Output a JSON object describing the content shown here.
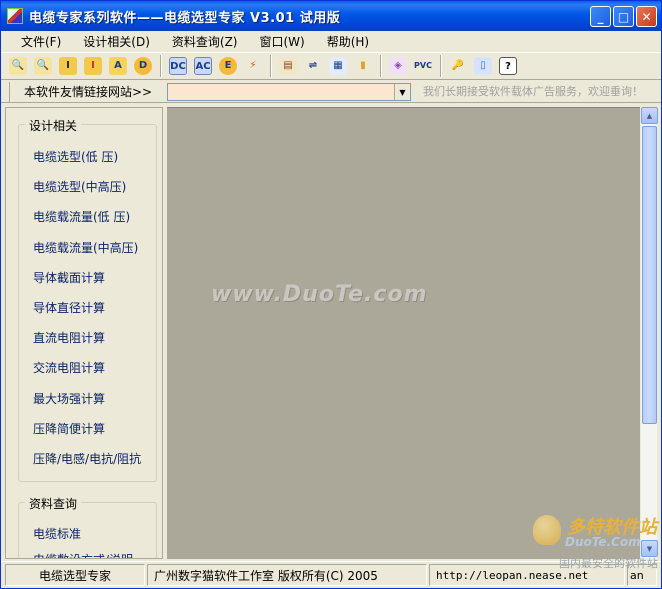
{
  "window": {
    "title": "电缆专家系列软件——电缆选型专家    V3.01  试用版",
    "buttons": {
      "minimize": "_",
      "maximize": "□",
      "close": "✕"
    }
  },
  "menu": [
    {
      "label": "文件(F)"
    },
    {
      "label": "设计相关(D)"
    },
    {
      "label": "资料查询(Z)"
    },
    {
      "label": "窗口(W)"
    },
    {
      "label": "帮助(H)"
    }
  ],
  "toolbar": {
    "buttons": [
      {
        "icon": "zoom-icon",
        "glyph": "🔍"
      },
      {
        "icon": "zoom-range-icon",
        "glyph": "🔍"
      },
      {
        "icon": "current-icon",
        "glyph": "I"
      },
      {
        "icon": "current-high-icon",
        "glyph": "I"
      },
      {
        "icon": "area-icon",
        "glyph": "A"
      },
      {
        "icon": "diameter-icon",
        "glyph": "D"
      },
      {
        "icon": "dc-icon",
        "glyph": "DC"
      },
      {
        "icon": "ac-icon",
        "glyph": "AC"
      },
      {
        "icon": "field-icon",
        "glyph": "E"
      },
      {
        "icon": "voltage-drop-icon",
        "glyph": "⚡"
      },
      {
        "icon": "standard-icon",
        "glyph": "▤"
      },
      {
        "icon": "install-icon",
        "glyph": "⇌"
      },
      {
        "icon": "search-doc-icon",
        "glyph": "▦"
      },
      {
        "icon": "ruler-icon",
        "glyph": "▮"
      },
      {
        "icon": "materials-icon",
        "glyph": "◈"
      },
      {
        "icon": "pvc-icon",
        "glyph": "PVC"
      },
      {
        "icon": "key-icon",
        "glyph": "🔑"
      },
      {
        "icon": "book-icon",
        "glyph": "▯"
      },
      {
        "icon": "help-icon",
        "glyph": "?"
      }
    ]
  },
  "linkbar": {
    "label": "本软件友情链接网站>>",
    "combo_value": "",
    "marquee": "我们长期接受软件载体广告服务，欢迎垂询！"
  },
  "panel": {
    "design_group": {
      "title": "设计相关",
      "items": [
        "电缆选型(低   压)",
        "电缆选型(中高压)",
        "电缆载流量(低   压)",
        "电缆载流量(中高压)",
        "导体截面计算",
        "导体直径计算",
        "直流电阻计算",
        "交流电阻计算",
        "最大场强计算",
        "压降简便计算",
        "压降/电感/电抗/阻抗"
      ]
    },
    "reference_group": {
      "title": "资料查询",
      "items": [
        "电缆标准",
        "电缆敷设方式/说明"
      ]
    }
  },
  "main": {
    "watermark": "www.DuoTe.com"
  },
  "corner_logo": {
    "cn": "多特软件站",
    "en": "DuoTe.Com",
    "sub": "国内最安全的软件站"
  },
  "status": {
    "app": "电缆选型专家",
    "copyright": "广州数字猫软件工作室 版权所有(C) 2005",
    "url": "http://leopan.nease.net",
    "extra": "an"
  },
  "colors": {
    "title_bar": "#0055E5",
    "panel_link": "#0A246A",
    "client_bg": "#ACA899",
    "combo_bg": "#FBE6D2"
  }
}
